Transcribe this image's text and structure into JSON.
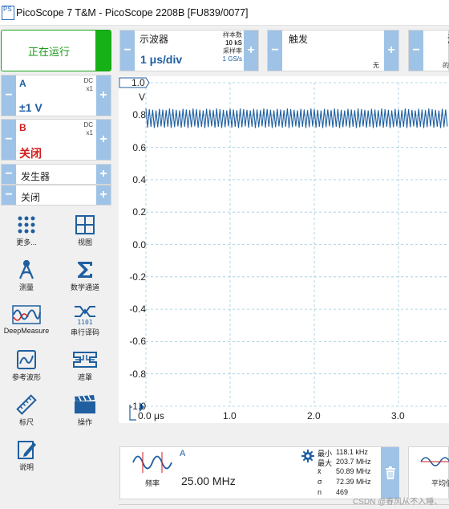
{
  "window": {
    "title": "PicoScope 7 T&M  - PicoScope 2208B [FU839/0077]",
    "logo": "PS"
  },
  "run": {
    "label": "正在运行"
  },
  "channels": [
    {
      "name": "A",
      "coupling": "DC",
      "probe": "x1",
      "range": "±1 V",
      "color": "#1f5fa0"
    },
    {
      "name": "B",
      "coupling": "DC",
      "probe": "x1",
      "range": "关闭",
      "color": "#d31b1b"
    }
  ],
  "generator": {
    "label": "发生器",
    "state": "关闭"
  },
  "tools": [
    {
      "icon": "more-icon",
      "label": "更多..."
    },
    {
      "icon": "view-icon",
      "label": "视图"
    },
    {
      "icon": "measure-icon",
      "label": "测量"
    },
    {
      "icon": "math-channel-icon",
      "label": "数学通道"
    },
    {
      "icon": "deepmeasure-icon",
      "label": "DeepMeasure"
    },
    {
      "icon": "serial-decode-icon",
      "label": "串行译码"
    },
    {
      "icon": "reference-waveform-icon",
      "label": "参考波形"
    },
    {
      "icon": "mask-icon",
      "label": "遮罩"
    },
    {
      "icon": "ruler-icon",
      "label": "标尺"
    },
    {
      "icon": "action-icon",
      "label": "操作"
    },
    {
      "icon": "notes-icon",
      "label": "说明"
    }
  ],
  "timebase": {
    "title": "示波器",
    "value": "1 μs/div",
    "samples_label": "样本数",
    "samples_value": "10 kS",
    "rate_label": "采样率",
    "rate_value": "1 GS/s"
  },
  "trigger": {
    "title": "触发",
    "mode": "无"
  },
  "third_panel": {
    "title": "涉",
    "sub": "的"
  },
  "plot": {
    "y_unit": "V",
    "y_marker": "1.0",
    "y_ticks": [
      "0.8",
      "0.6",
      "0.4",
      "0.2",
      "0.0",
      "-0.2",
      "-0.4",
      "-0.6",
      "-0.8",
      "-1.0"
    ],
    "x_ticks": [
      "0.0 μs",
      "1.0",
      "2.0",
      "3.0"
    ],
    "signal": {
      "frequency": "25.00 MHz",
      "level_min": 0.72,
      "level_max": 0.84
    },
    "trace_color": "#1f5fa0",
    "grid_color": "#9ccbe0"
  },
  "measurement": {
    "channel": "A",
    "name": "频率",
    "value": "25.00 MHz",
    "stats": [
      {
        "label": "最小",
        "value": "118.1 kHz"
      },
      {
        "label": "最大",
        "value": "203.7 MHz"
      },
      {
        "label": "x̄",
        "value": "50.89 MHz"
      },
      {
        "label": "σ",
        "value": "72.39 MHz"
      },
      {
        "label": "n",
        "value": "469"
      }
    ]
  },
  "measurement2": {
    "name": "平均值"
  },
  "watermark": "CSDN @春风从不入睡、"
}
